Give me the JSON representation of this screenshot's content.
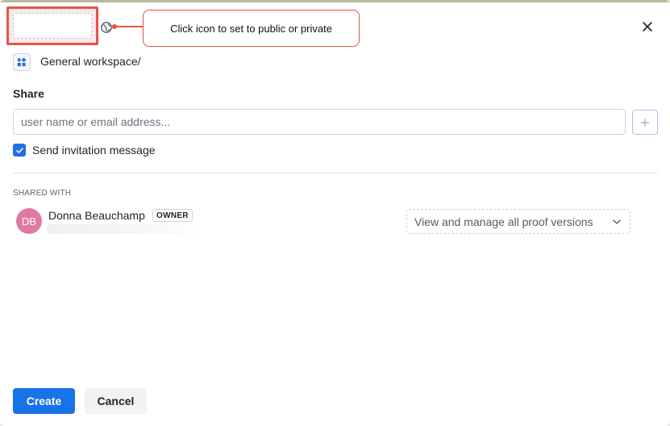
{
  "title": {
    "value": "",
    "placeholder": ""
  },
  "callout": {
    "text": "Click icon to set to public or private"
  },
  "workspace": {
    "label": "General workspace/"
  },
  "share": {
    "heading": "Share",
    "input_placeholder": "user name or email address...",
    "input_value": ""
  },
  "invitation": {
    "label": "Send invitation message",
    "checked": true
  },
  "shared_with": {
    "heading": "SHARED WITH",
    "people": [
      {
        "initials": "DB",
        "name": "Donna Beauchamp",
        "badge": "OWNER",
        "permission": "View and manage all proof versions"
      }
    ]
  },
  "footer": {
    "create_label": "Create",
    "cancel_label": "Cancel"
  },
  "colors": {
    "primary": "#1872e8",
    "annotation": "#e5534b",
    "avatar": "#e07aa3"
  },
  "icons": [
    "globe-icon",
    "close-icon",
    "workspace-icon",
    "plus-icon",
    "check-icon",
    "chevron-down-icon"
  ]
}
